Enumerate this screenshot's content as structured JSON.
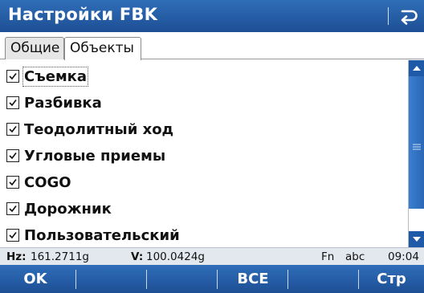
{
  "window": {
    "title": "Настройки FBK"
  },
  "icons": {
    "back": "back-return-icon",
    "checkbox": "checkbox-checked-icon",
    "up": "arrow-up-icon",
    "down": "arrow-down-icon",
    "grip": "scroll-grip-icon"
  },
  "tabs": [
    {
      "label": "Общие",
      "active": false
    },
    {
      "label": "Объекты",
      "active": true
    }
  ],
  "items": [
    {
      "label": "Съемка",
      "checked": true,
      "focused": true
    },
    {
      "label": "Разбивка",
      "checked": true
    },
    {
      "label": "Теодолитный ход",
      "checked": true
    },
    {
      "label": "Угловые приемы",
      "checked": true
    },
    {
      "label": "COGO",
      "checked": true
    },
    {
      "label": "Дорожник",
      "checked": true
    },
    {
      "label": "Пользовательский",
      "checked": true
    }
  ],
  "status": {
    "hz_label": "Hz:",
    "hz_value": "161.2711g",
    "v_label": "V:",
    "v_value": "100.0424g",
    "fn": "Fn",
    "input_mode": "abc",
    "time": "09:04"
  },
  "softkeys": [
    "OK",
    "",
    "",
    "ВСЕ",
    "",
    "Стр"
  ],
  "colors": {
    "bar": "#1d4f94",
    "bar_light": "#2f6eb8",
    "status_bg": "#e3e8ef"
  }
}
